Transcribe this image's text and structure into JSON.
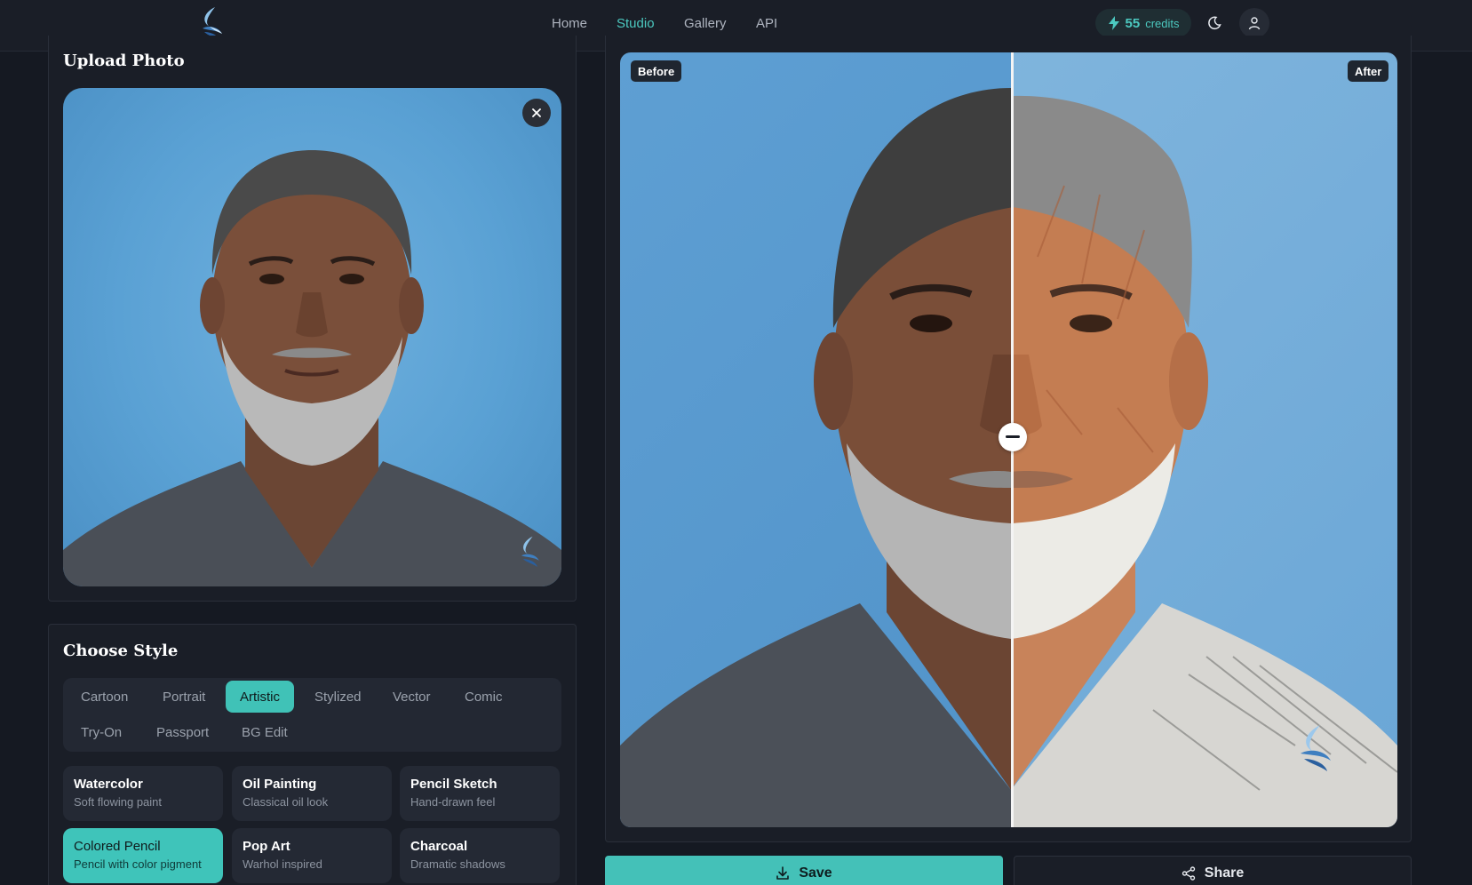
{
  "header": {
    "nav": [
      "Home",
      "Studio",
      "Gallery",
      "API"
    ],
    "active_nav": "Studio",
    "credits_count": "55",
    "credits_label": "credits",
    "icons": [
      "bolt-icon",
      "moon-icon",
      "user-icon"
    ]
  },
  "upload": {
    "title": "Upload Photo"
  },
  "style": {
    "title": "Choose Style",
    "tabs": [
      "Cartoon",
      "Portrait",
      "Artistic",
      "Stylized",
      "Vector",
      "Comic",
      "Try-On",
      "Passport",
      "BG Edit"
    ],
    "active_tab": "Artistic",
    "cards": [
      {
        "title": "Watercolor",
        "sub": "Soft flowing paint"
      },
      {
        "title": "Oil Painting",
        "sub": "Classical oil look"
      },
      {
        "title": "Pencil Sketch",
        "sub": "Hand-drawn feel"
      },
      {
        "title": "Colored Pencil",
        "sub": "Pencil with color pigment"
      },
      {
        "title": "Pop Art",
        "sub": "Warhol inspired"
      },
      {
        "title": "Charcoal",
        "sub": "Dramatic shadows"
      }
    ],
    "active_card": "Colored Pencil"
  },
  "compare": {
    "before_label": "Before",
    "after_label": "After"
  },
  "actions": {
    "save_label": "Save",
    "share_label": "Share"
  },
  "colors": {
    "accent": "#44c1b8",
    "background": "#151922",
    "panel": "#1a1e27",
    "photo_bg": "#5aa1d4"
  }
}
